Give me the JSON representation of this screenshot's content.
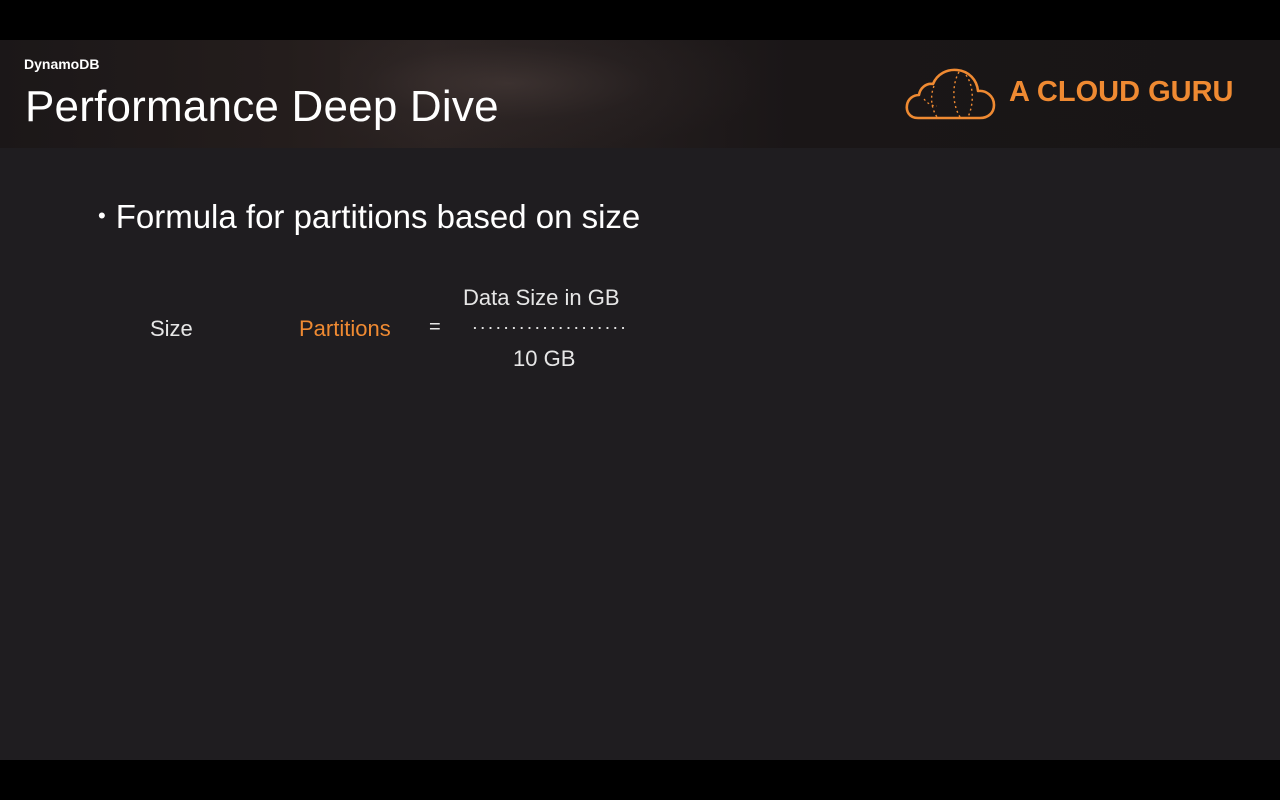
{
  "header": {
    "subtitle": "DynamoDB",
    "title": "Performance Deep Dive",
    "logo_text": "A CLOUD GURU",
    "logo_icon": "cloud-icon"
  },
  "content": {
    "bullet": "Formula for partitions based on size",
    "formula": {
      "label": "Size",
      "result": "Partitions",
      "equals": "=",
      "numerator": "Data Size in GB",
      "denominator": "10 GB"
    }
  },
  "colors": {
    "accent": "#ef8a32",
    "background": "#1f1d20",
    "text": "#ffffff"
  }
}
